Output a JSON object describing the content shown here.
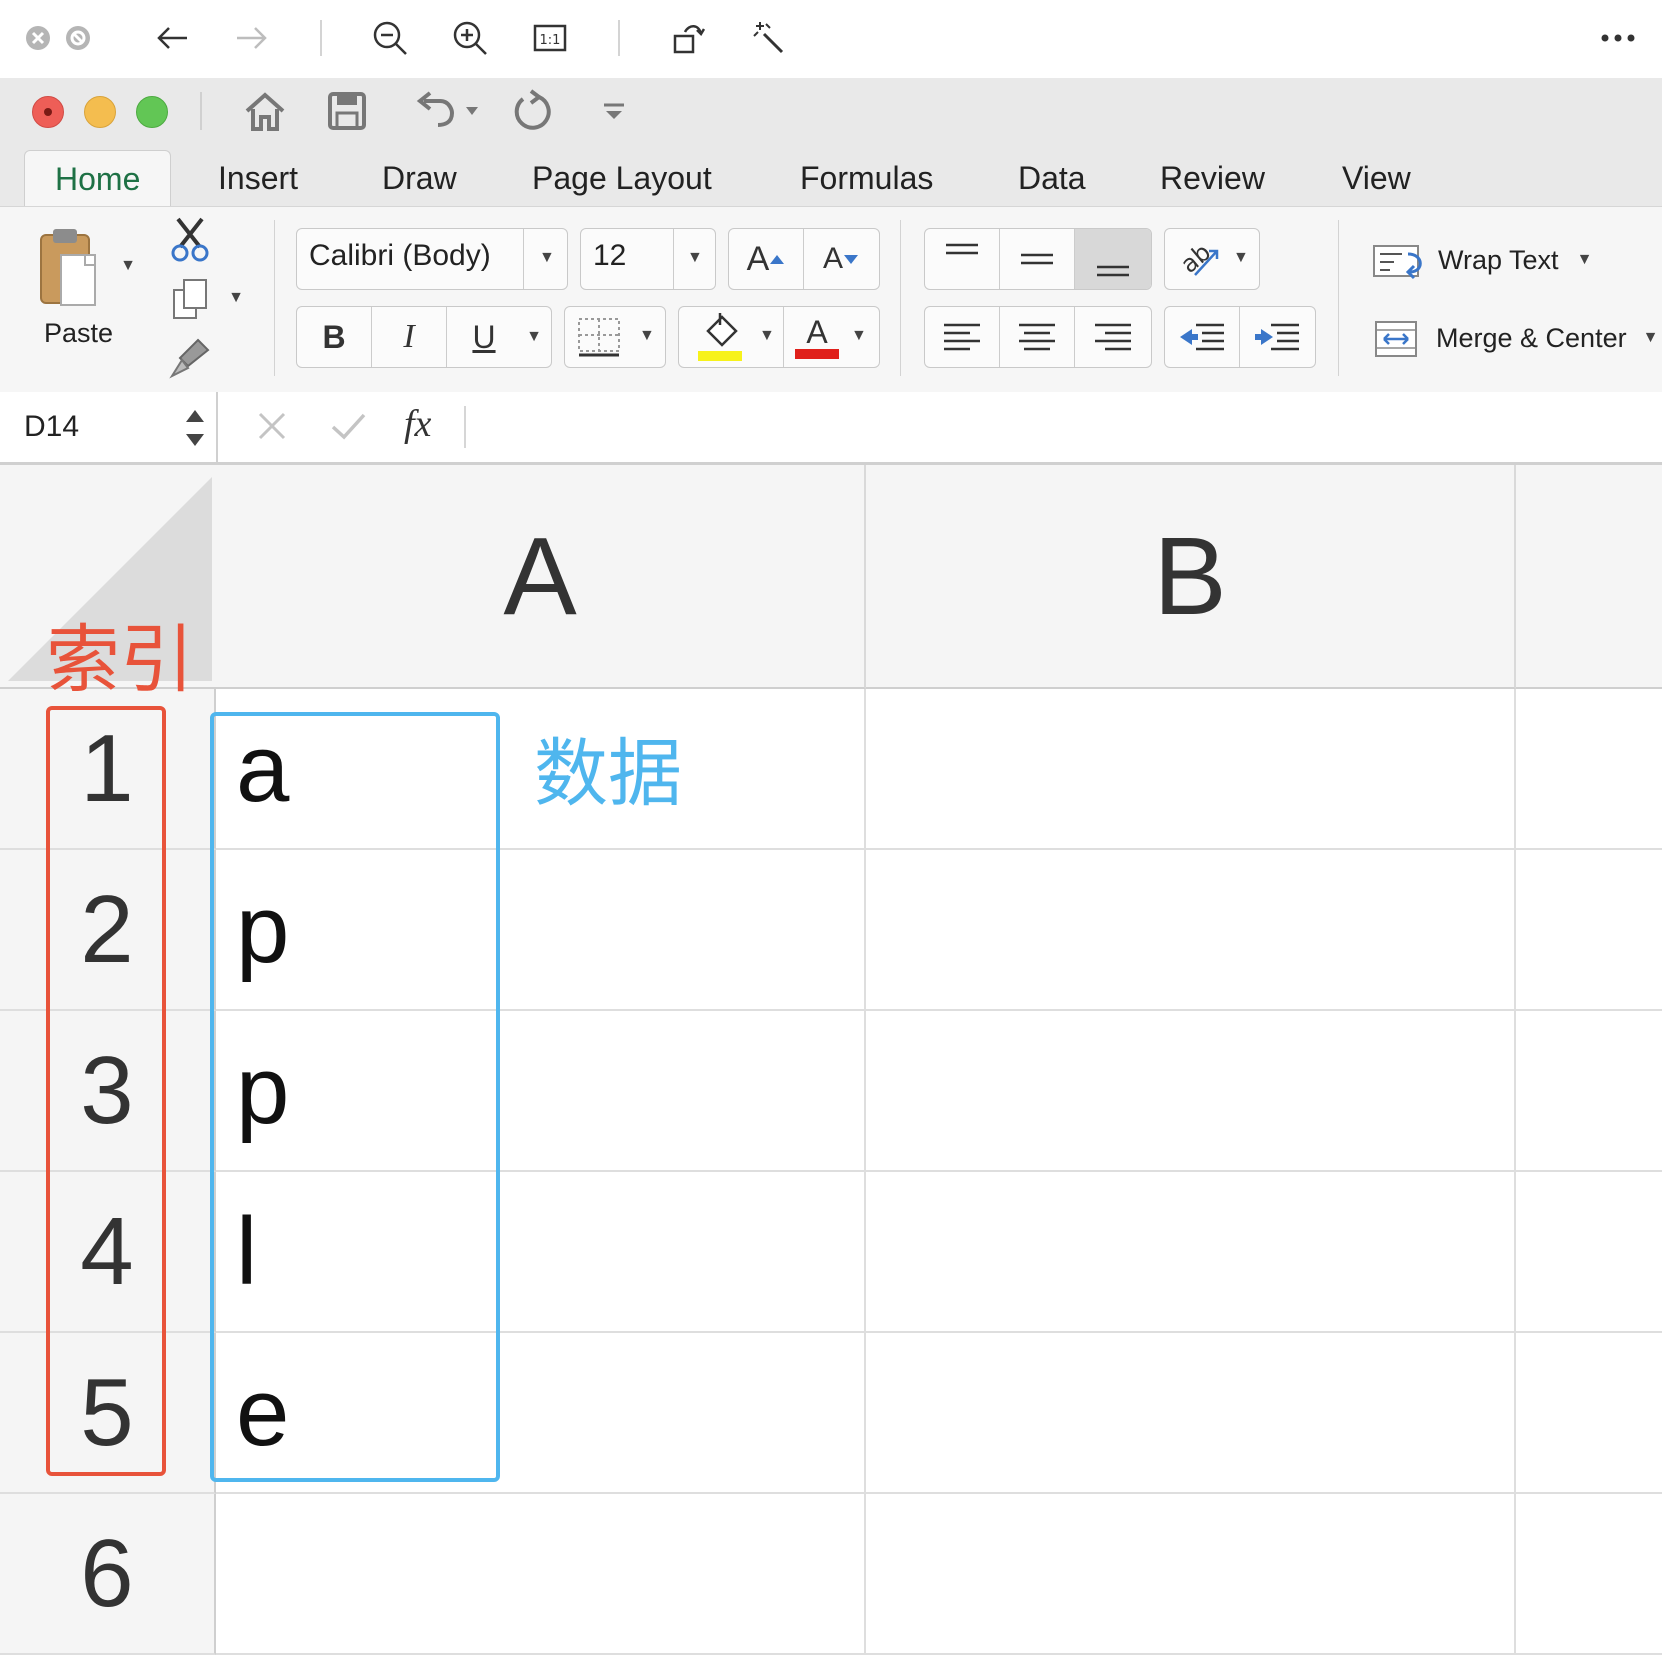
{
  "viewer_toolbar": {
    "icons": [
      "close-icon",
      "block-icon",
      "back-arrow-icon",
      "forward-arrow-icon",
      "zoom-out-icon",
      "zoom-in-icon",
      "actual-size-icon",
      "rotate-icon",
      "magic-wand-icon",
      "more-icon"
    ]
  },
  "window": {
    "tabs": [
      "Home",
      "Insert",
      "Draw",
      "Page Layout",
      "Formulas",
      "Data",
      "Review",
      "View"
    ],
    "active_tab": "Home"
  },
  "ribbon": {
    "paste_label": "Paste",
    "font_name": "Calibri (Body)",
    "font_size": "12",
    "grow_font": "A",
    "shrink_font": "A",
    "bold": "B",
    "italic": "I",
    "underline": "U",
    "font_color_glyph": "A",
    "wrap_text": "Wrap Text",
    "merge_center": "Merge & Center",
    "fill_color": "#f7f21b",
    "font_color": "#e0201b"
  },
  "formula_bar": {
    "name_box": "D14",
    "fx": "fx",
    "formula": ""
  },
  "sheet": {
    "columns": [
      "A",
      "B"
    ],
    "rows": [
      "1",
      "2",
      "3",
      "4",
      "5",
      "6"
    ],
    "column_a_values": [
      "a",
      "p",
      "p",
      "l",
      "e",
      ""
    ]
  },
  "annotations": {
    "index_label": "索引",
    "data_label": "数据",
    "index_color": "#e8533a",
    "data_color": "#4fb6ee"
  }
}
